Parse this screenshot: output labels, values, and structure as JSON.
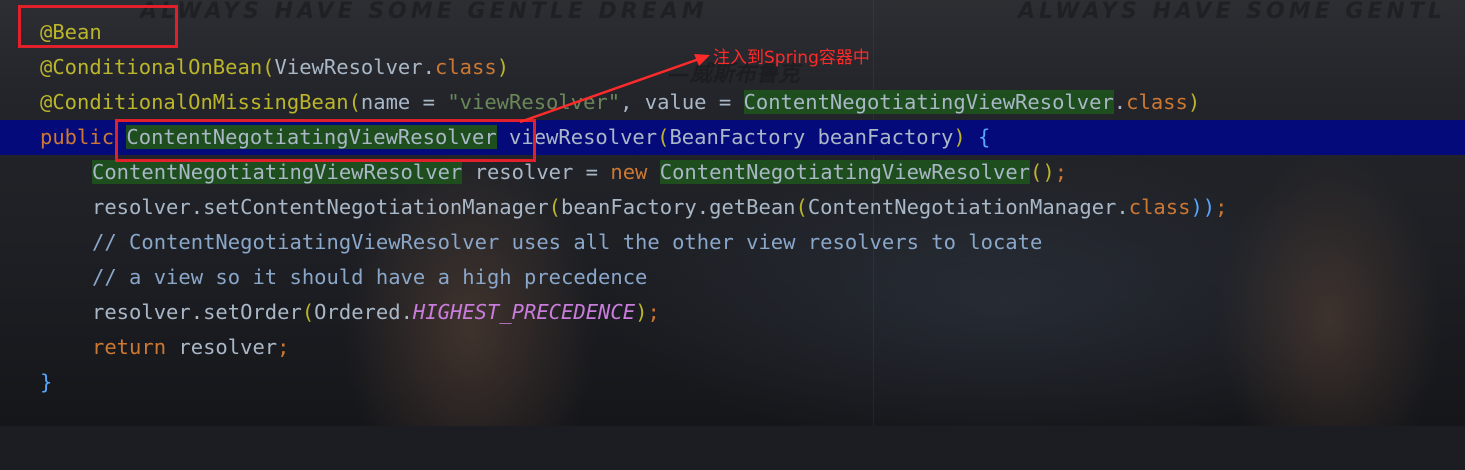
{
  "watermark": {
    "top_left": "ALWAYS HAVE SOME GENTLE DREAM",
    "top_right": "ALWAYS HAVE SOME GENTL",
    "signature": "—威斯布鲁克"
  },
  "annotation": {
    "callout_text": "注入到Spring容器中",
    "box_color": "#e0202a",
    "arrow_color": "#ff2a2a"
  },
  "code": {
    "line1": {
      "ann": "@Bean"
    },
    "line2": {
      "ann": "@ConditionalOnBean",
      "p1": "(",
      "type": "ViewResolver",
      "dot": ".",
      "kw": "class",
      "p2": ")"
    },
    "line3": {
      "ann": "@ConditionalOnMissingBean",
      "p1": "(",
      "a": "name = ",
      "str": "\"viewResolver\"",
      "b": ", value = ",
      "type": "ContentNegotiatingViewResolver",
      "dot": ".",
      "kw": "class",
      "p2": ")"
    },
    "line4": {
      "kw": "public ",
      "type": "ContentNegotiatingViewResolver",
      "a": " viewResolver",
      "p1": "(",
      "b": "BeanFactory beanFactory",
      "p2": ")",
      "c": " ",
      "brace": "{"
    },
    "line5": {
      "type": "ContentNegotiatingViewResolver",
      "a": " resolver = ",
      "kw": "new ",
      "type2": "ContentNegotiatingViewResolver",
      "p": "()",
      "semi": ";"
    },
    "line6": {
      "a": "resolver.setContentNegotiationManager",
      "p1": "(",
      "b": "beanFactory.getBean",
      "p2": "(",
      "c": "ContentNegotiationManager.",
      "kw": "class",
      "p3": "))",
      "semi": ";"
    },
    "line7": {
      "cmt": "// ContentNegotiatingViewResolver uses all the other view resolvers to locate"
    },
    "line8": {
      "cmt": "// a view so it should have a high precedence"
    },
    "line9": {
      "a": "resolver.setOrder",
      "p1": "(",
      "b": "Ordered.",
      "cst": "HIGHEST_PRECEDENCE",
      "p2": ")",
      "semi": ";"
    },
    "line10": {
      "kw": "return ",
      "a": "resolver",
      "semi": ";"
    },
    "line11": {
      "brace": "}"
    }
  }
}
